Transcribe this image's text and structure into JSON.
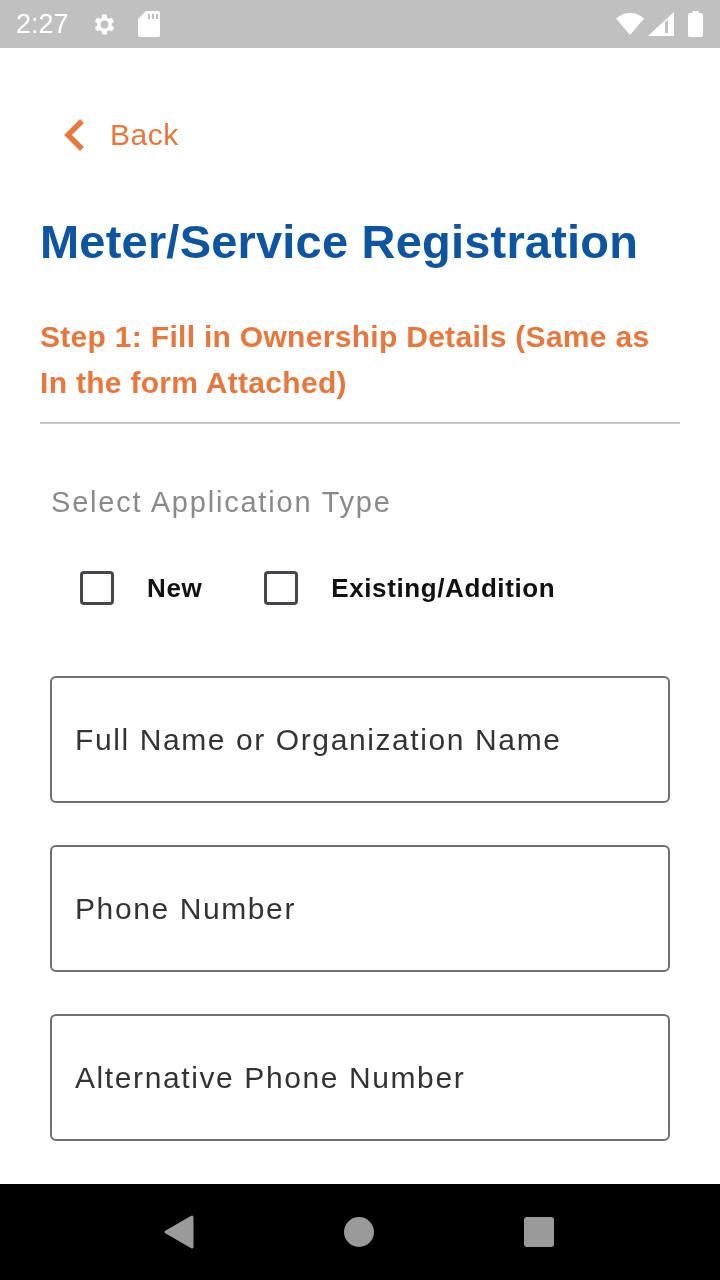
{
  "status_bar": {
    "time": "2:27"
  },
  "back": {
    "label": "Back"
  },
  "title": "Meter/Service Registration",
  "step": "Step 1: Fill in Ownership Details (Same as In the form Attached)",
  "application_type": {
    "label": "Select Application Type",
    "options": [
      {
        "label": "New",
        "checked": false
      },
      {
        "label": "Existing/Addition",
        "checked": false
      }
    ]
  },
  "fields": [
    {
      "placeholder": "Full Name or Organization Name"
    },
    {
      "placeholder": "Phone Number"
    },
    {
      "placeholder": "Alternative Phone Number"
    }
  ]
}
